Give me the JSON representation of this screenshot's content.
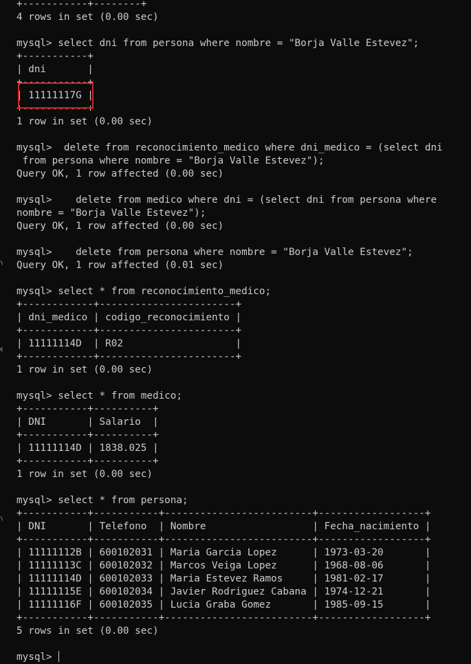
{
  "terminal": {
    "lines": [
      "+-----------+--------+",
      "4 rows in set (0.00 sec)",
      "",
      "mysql> select dni from persona where nombre = \"Borja Valle Estevez\";",
      "+-----------+",
      "| dni       |",
      "+-----------+",
      "| 11111117G |",
      "+-----------+",
      "1 row in set (0.00 sec)",
      "",
      "mysql>  delete from reconocimiento_medico where dni_medico = (select dni",
      " from persona where nombre = \"Borja Valle Estevez\");",
      "Query OK, 1 row affected (0.00 sec)",
      "",
      "mysql>    delete from medico where dni = (select dni from persona where",
      "nombre = \"Borja Valle Estevez\");",
      "Query OK, 1 row affected (0.00 sec)",
      "",
      "mysql>    delete from persona where nombre = \"Borja Valle Estevez\";",
      "Query OK, 1 row affected (0.01 sec)",
      "",
      "mysql> select * from reconocimiento_medico;",
      "+------------+-----------------------+",
      "| dni_medico | codigo_reconocimiento |",
      "+------------+-----------------------+",
      "| 11111114D  | R02                   |",
      "+------------+-----------------------+",
      "1 row in set (0.00 sec)",
      "",
      "mysql> select * from medico;",
      "+-----------+----------+",
      "| DNI       | Salario  |",
      "+-----------+----------+",
      "| 11111114D | 1838.025 |",
      "+-----------+----------+",
      "1 row in set (0.00 sec)",
      "",
      "mysql> select * from persona;",
      "+-----------+-----------+-------------------------+------------------+",
      "| DNI       | Telefono  | Nombre                  | Fecha_nacimiento |",
      "+-----------+-----------+-------------------------+------------------+",
      "| 11111112B | 600102031 | Maria Garcia Lopez      | 1973-03-20       |",
      "| 11111113C | 600102032 | Marcos Veiga Lopez      | 1968-08-06       |",
      "| 11111114D | 600102033 | Maria Estevez Ramos     | 1981-02-17       |",
      "| 11111115E | 600102034 | Javier Rodriguez Cabana | 1974-12-21       |",
      "| 11111116F | 600102035 | Lucia Graba Gomez       | 1985-09-15       |",
      "+-----------+-----------+-------------------------+------------------+",
      "5 rows in set (0.00 sec)",
      ""
    ],
    "prompt": "mysql> ",
    "edge_fragments": [
      "e",
      "\\",
      "\\"
    ]
  },
  "colors": {
    "background": "#0c0c0c",
    "text": "#cccccc",
    "highlight": "#e02020"
  }
}
